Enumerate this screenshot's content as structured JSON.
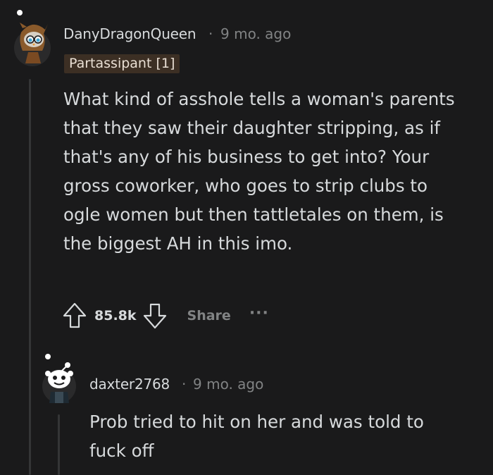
{
  "comment": {
    "username": "DanyDragonQueen",
    "separator": "·",
    "time": "9 mo. ago",
    "flair": "Partassipant [1]",
    "body": "What kind of asshole tells a woman's parents that they saw their daughter stripping, as if that's any of his business to get into? Your gross coworker, who goes to strip clubs to ogle women but then tattletales on them, is the biggest AH in this imo.",
    "votes": "85.8k",
    "share_label": "Share",
    "more_label": "···",
    "avatar_icon": "owl-snoo-avatar-icon",
    "upvote_icon": "upvote-arrow-icon",
    "downvote_icon": "downvote-arrow-icon"
  },
  "reply": {
    "username": "daxter2768",
    "separator": "·",
    "time": "9 mo. ago",
    "body": "Prob tried to hit on her and was told to fuck off",
    "avatar_icon": "snoo-avatar-icon"
  },
  "colors": {
    "background": "#1a1a1b",
    "text": "#d7dadc",
    "muted": "#818384",
    "flair_bg": "#3c2f24",
    "thread_line": "#343536"
  }
}
